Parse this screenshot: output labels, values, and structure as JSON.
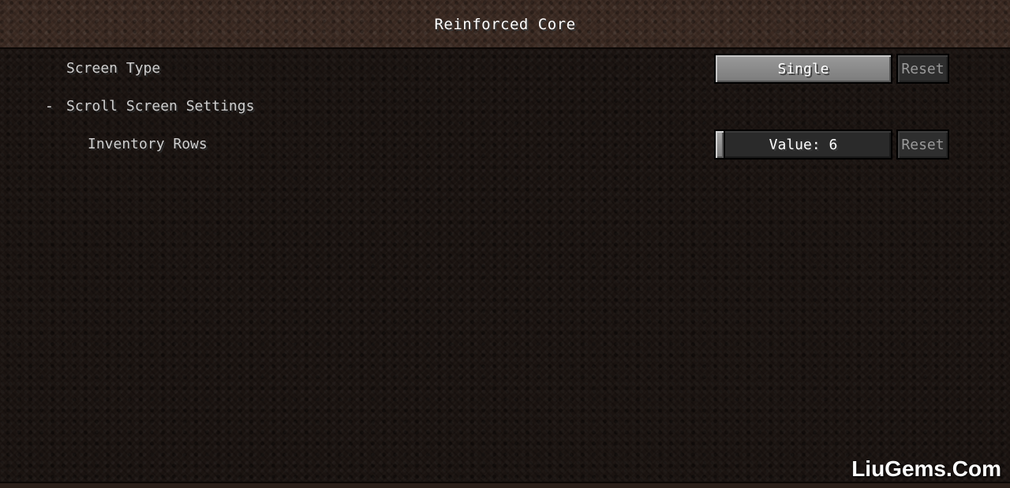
{
  "header": {
    "title": "Reinforced Core"
  },
  "rows": {
    "screen_type": {
      "label": "Screen Type",
      "value": "Single",
      "reset_label": "Reset"
    },
    "scroll_screen_settings": {
      "toggle": "-",
      "label": "Scroll Screen Settings"
    },
    "inventory_rows": {
      "label": "Inventory Rows",
      "value_text": "Value: 6",
      "value": 6,
      "reset_label": "Reset"
    }
  },
  "watermark": {
    "text": "LiuGems.Com"
  }
}
